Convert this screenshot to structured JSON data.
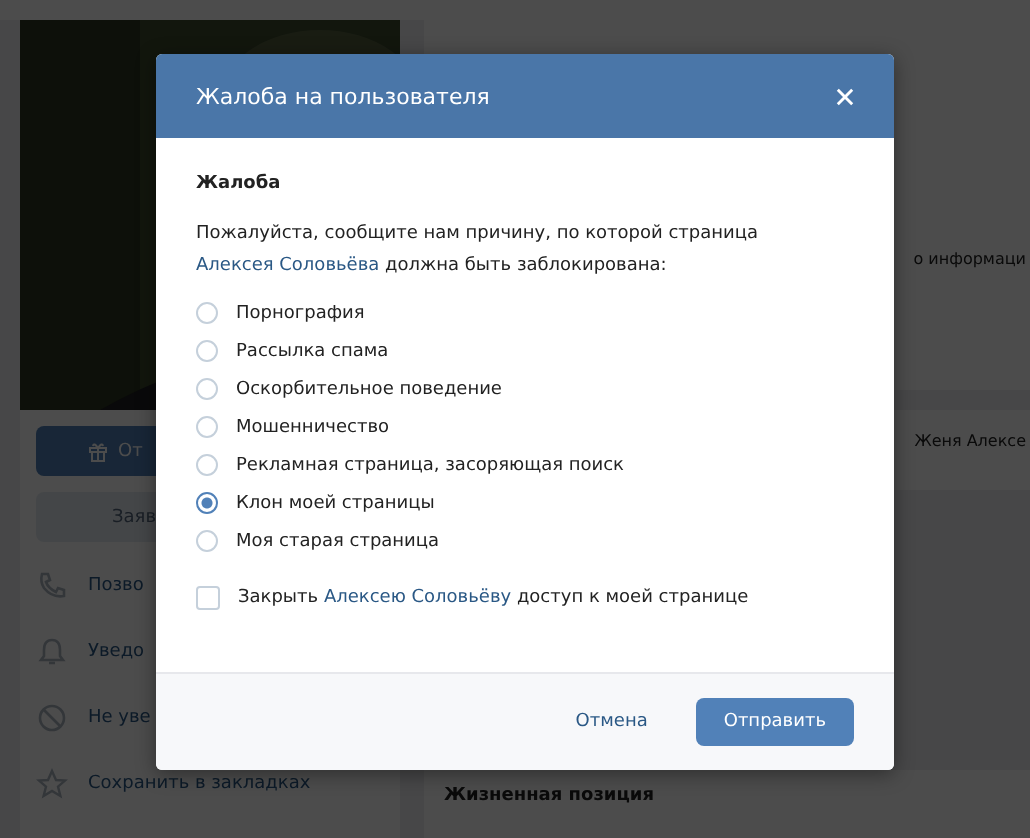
{
  "background_page": {
    "profile_buttons": [
      {
        "label": "От",
        "kind": "primary"
      },
      {
        "label": "Заяв",
        "kind": "secondary"
      }
    ],
    "menu": [
      {
        "label": "Позво",
        "kind": "phone"
      },
      {
        "label": "Уведо",
        "kind": "bell"
      },
      {
        "label": "Не уве",
        "kind": "muted"
      },
      {
        "label": "Сохранить в закладках",
        "kind": "star"
      }
    ],
    "info_fragment": "о информаци",
    "friend_name": "Женя Алексе",
    "section_title": "Жизненная позиция"
  },
  "dialog": {
    "title": "Жалоба на пользователя",
    "heading": "Жалоба",
    "intro": {
      "before": "Пожалуйста, сообщите нам причину, по которой страница",
      "link": "Алексея Соловьёва",
      "after": "должна быть заблокирована:"
    },
    "options": [
      {
        "label": "Порнография",
        "selected": false
      },
      {
        "label": "Рассылка спама",
        "selected": false
      },
      {
        "label": "Оскорбительное поведение",
        "selected": false
      },
      {
        "label": "Мошенничество",
        "selected": false
      },
      {
        "label": "Рекламная страница, засоряющая поиск",
        "selected": false
      },
      {
        "label": "Клон моей страницы",
        "selected": true
      },
      {
        "label": "Моя старая страница",
        "selected": false
      }
    ],
    "block_access": {
      "checked": false,
      "before": "Закрыть",
      "link": "Алексею Соловьёву",
      "after": "доступ к моей странице"
    },
    "buttons": {
      "cancel": "Отмена",
      "submit": "Отправить"
    }
  }
}
